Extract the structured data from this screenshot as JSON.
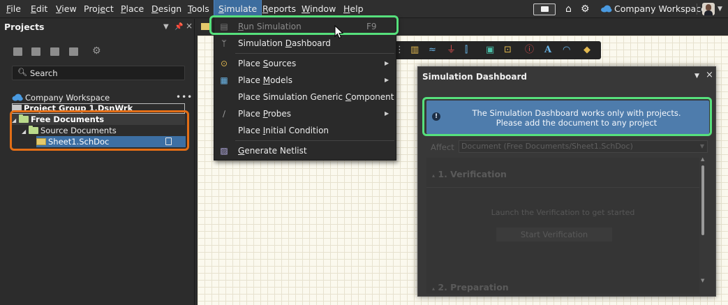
{
  "menubar": {
    "items": [
      {
        "label": "File",
        "u": "F",
        "rest": "ile"
      },
      {
        "label": "Edit",
        "u": "E",
        "rest": "dit"
      },
      {
        "label": "View",
        "u": "V",
        "rest": "iew"
      },
      {
        "label": "Project",
        "pre": "Proj",
        "u": "e",
        "rest": "ct"
      },
      {
        "label": "Place",
        "u": "P",
        "rest": "lace"
      },
      {
        "label": "Design",
        "u": "D",
        "rest": "esign"
      },
      {
        "label": "Tools",
        "u": "T",
        "rest": "ools"
      },
      {
        "label": "Simulate",
        "u": "S",
        "rest": "imulate"
      },
      {
        "label": "Reports",
        "u": "R",
        "rest": "eports"
      },
      {
        "label": "Window",
        "u": "W",
        "rest": "indow"
      },
      {
        "label": "Help",
        "u": "H",
        "rest": "elp"
      }
    ],
    "workspace_label": "Company Workspace"
  },
  "projects_panel": {
    "title": "Projects",
    "search_placeholder": "Search",
    "workspace_row": "Company Workspace",
    "project_group_row": "Project Group 1.DsnWrk",
    "free_documents": "Free Documents",
    "source_documents": "Source Documents",
    "sheet": "Sheet1.SchDoc",
    "more": "•••"
  },
  "sim_menu": {
    "run": {
      "pre": "",
      "u": "R",
      "rest": "un Simulation",
      "shortcut": "F9"
    },
    "dashboard": {
      "pre": "Simulation ",
      "u": "D",
      "rest": "ashboard"
    },
    "sources": {
      "pre": "Place ",
      "u": "S",
      "rest": "ources"
    },
    "models": {
      "pre": "Place ",
      "u": "M",
      "rest": "odels"
    },
    "generic": {
      "pre": "Place Simulation Generic ",
      "u": "C",
      "rest": "omponent"
    },
    "probes": {
      "pre": "Place ",
      "u": "P",
      "rest": "robes"
    },
    "initial": {
      "pre": "Place ",
      "u": "I",
      "rest": "nitial Condition"
    },
    "netlist": {
      "pre": "",
      "u": "G",
      "rest": "enerate Netlist"
    }
  },
  "dashboard": {
    "title": "Simulation Dashboard",
    "message_line1": "The Simulation Dashboard works only with projects.",
    "message_line2": "Please add the document to any project",
    "affect_label": "Affect",
    "affect_value": "Document (Free Documents/Sheet1.SchDoc)",
    "verification_header": "1. Verification",
    "verification_hint": "Launch the Verification to get started",
    "start_verification": "Start Verification",
    "preparation_header": "2. Preparation"
  },
  "colors": {
    "accent_blue": "#3d6fa3",
    "highlight_green": "#56e07c",
    "highlight_orange": "#e36e16"
  }
}
